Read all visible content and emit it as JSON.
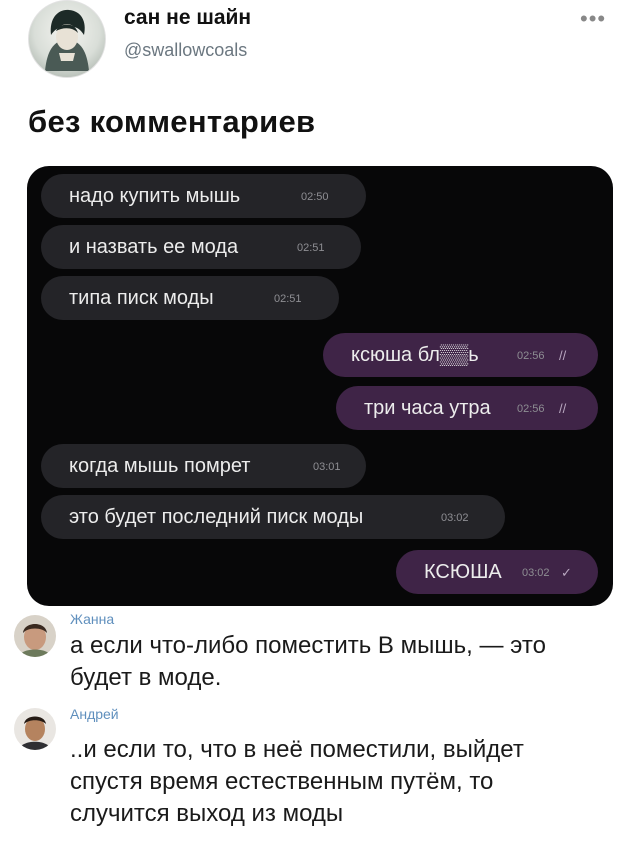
{
  "tweet": {
    "author_name": "сан не шайн",
    "author_handle": "@swallowcoals",
    "more_label": "•••",
    "text": "без комментариев"
  },
  "chat": {
    "messages": [
      {
        "text": "надо купить мышь",
        "time": "02:50",
        "dir": "in"
      },
      {
        "text": "и назвать ее мода",
        "time": "02:51",
        "dir": "in"
      },
      {
        "text": "типа писк моды",
        "time": "02:51",
        "dir": "in"
      },
      {
        "text": "ксюша бл▒▒ь",
        "time": "02:56",
        "dir": "out",
        "status": "//"
      },
      {
        "text": "три часа утра",
        "time": "02:56",
        "dir": "out",
        "status": "//"
      },
      {
        "text": "когда мышь помрет",
        "time": "03:01",
        "dir": "in"
      },
      {
        "text": "это будет последний писк  моды",
        "time": "03:02",
        "dir": "in"
      },
      {
        "text": "КСЮША",
        "time": "03:02",
        "dir": "out",
        "status": "✓"
      }
    ]
  },
  "comments": [
    {
      "author": "Жанна",
      "lines": [
        "а если что-либо поместить В мышь, — это",
        "будет в моде."
      ]
    },
    {
      "author": "Андрей",
      "lines": [
        "..и если то, что в неё поместили, выйдет",
        "спустя время естественным путём, то",
        "случится выход из моды"
      ]
    }
  ]
}
